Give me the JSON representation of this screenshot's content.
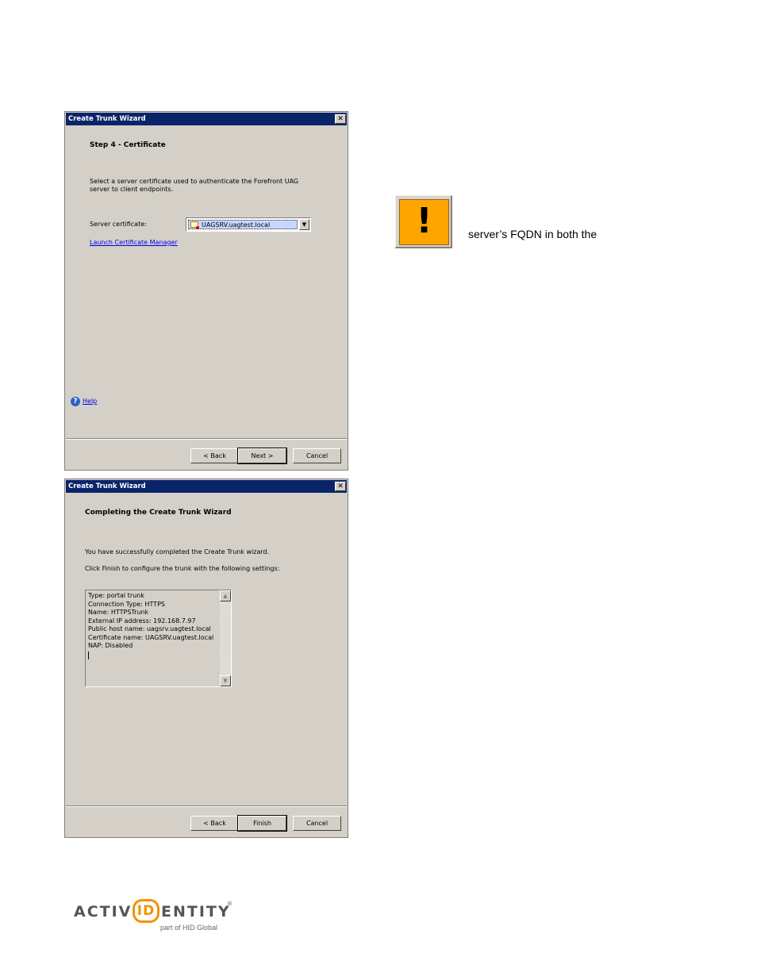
{
  "wizard_step4": {
    "title": "Create Trunk Wizard",
    "heading": "Step 4 - Certificate",
    "description_line1": "Select a server certificate used to authenticate the Forefront UAG",
    "description_line2": "server to client endpoints.",
    "server_cert_label": "Server certificate:",
    "server_cert_value": "UAGSRV.uagtest.local",
    "launch_link": "Launch Certificate Manager",
    "help_link": "Help",
    "back_button": "< Back",
    "next_button": "Next >",
    "cancel_button": "Cancel"
  },
  "wizard_complete": {
    "title": "Create Trunk Wizard",
    "heading": "Completing the Create Trunk Wizard",
    "success_text": "You have successfully completed the Create Trunk wizard.",
    "instruction_text": "Click Finish to configure the trunk with the following settings:",
    "settings": [
      "Type: portal trunk",
      "Connection Type: HTTPS",
      "Name: HTTPSTrunk",
      "External IP address: 192.168.7.97",
      "Public host name: uagsrv.uagtest.local",
      "Certificate name: UAGSRV.uagtest.local",
      "NAP: Disabled"
    ],
    "back_button": "< Back",
    "finish_button": "Finish",
    "cancel_button": "Cancel"
  },
  "note": {
    "icon": "exclamation-warning-icon",
    "accent_color": "#ffa500",
    "text": "server’s FQDN in both the"
  },
  "logo": {
    "word_left": "ACTIV",
    "word_mark": "ID",
    "word_right": "ENTITY",
    "registered": "®",
    "tagline": "part of HID Global",
    "brand_color": "#f39200"
  }
}
